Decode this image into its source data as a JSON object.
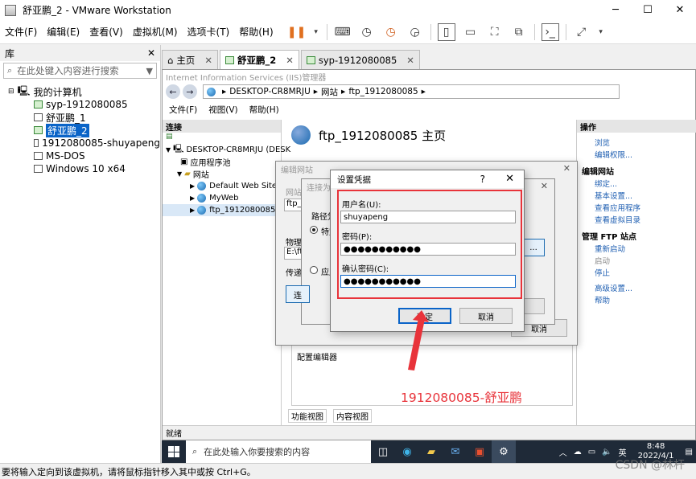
{
  "window": {
    "title": "舒亚鹏_2 - VMware Workstation"
  },
  "vm_menu": [
    "文件(F)",
    "编辑(E)",
    "查看(V)",
    "虚拟机(M)",
    "选项卡(T)",
    "帮助(H)"
  ],
  "library": {
    "title": "库",
    "search_placeholder": "在此处键入内容进行搜索",
    "root": "我的计算机",
    "items": [
      "syp-1912080085",
      "舒亚鹏_1",
      "舒亚鹏_2",
      "1912080085-shuyapeng",
      "MS-DOS",
      "Windows 10 x64"
    ],
    "selected": "舒亚鹏_2"
  },
  "tabs": [
    {
      "label": "主页"
    },
    {
      "label": "舒亚鹏_2"
    },
    {
      "label": "syp-1912080085"
    }
  ],
  "iis": {
    "title": "Internet Information Services (IIS)管理器",
    "address": [
      "DESKTOP-CR8MRJU",
      "网站",
      "ftp_1912080085"
    ],
    "menu": [
      "文件(F)",
      "视图(V)",
      "帮助(H)"
    ],
    "connections_title": "连接",
    "tree": {
      "server": "DESKTOP-CR8MRJU (DESK",
      "app_pools": "应用程序池",
      "sites": "网站",
      "site_list": [
        "Default Web Site",
        "MyWeb",
        "ftp_1912080085"
      ]
    },
    "page_title": "ftp_1912080085 主页",
    "config_editor": "配置编辑器",
    "view_tabs": [
      "功能视图",
      "内容视图"
    ],
    "status": "就绪",
    "actions": {
      "title": "操作",
      "top": [
        "浏览",
        "编辑权限..."
      ],
      "edit_site_group": "编辑网站",
      "edit_site": [
        "绑定...",
        "基本设置...",
        "查看应用程序",
        "查看虚拟目录"
      ],
      "ftp_group": "管理 FTP 站点",
      "ftp": [
        "重新启动",
        "启动",
        "停止"
      ],
      "advanced": "高级设置...",
      "help": "帮助"
    }
  },
  "edit_dialog": {
    "title": "编辑网站",
    "site_label": "网站",
    "site_value": "ftp_1",
    "physical_label": "物理",
    "physical_value": "E:\\ftp",
    "pass_label": "传递",
    "cancel": "取消"
  },
  "connect_dialog": {
    "title": "连接为",
    "path_label": "路径凭",
    "specific": "特定",
    "app": "应用",
    "conn_btn": "连",
    "ellipsis": "..."
  },
  "cred_dialog": {
    "title": "设置凭据",
    "help": "?",
    "username_label": "用户名(U):",
    "username_value": "shuyapeng",
    "password_label": "密码(P):",
    "password_value": "●●●●●●●●●●●",
    "confirm_label": "确认密码(C):",
    "confirm_value": "●●●●●●●●●●●",
    "ok": "确定",
    "cancel": "取消"
  },
  "annotation": "1912080085-舒亚鹏",
  "taskbar": {
    "search_placeholder": "在此处输入你要搜索的内容",
    "ime": "英",
    "time": "8:48",
    "date": "2022/4/1"
  },
  "status_bar": "要将输入定向到该虚拟机，请将鼠标指针移入其中或按 Ctrl+G。",
  "watermark": "CSDN @林杆"
}
